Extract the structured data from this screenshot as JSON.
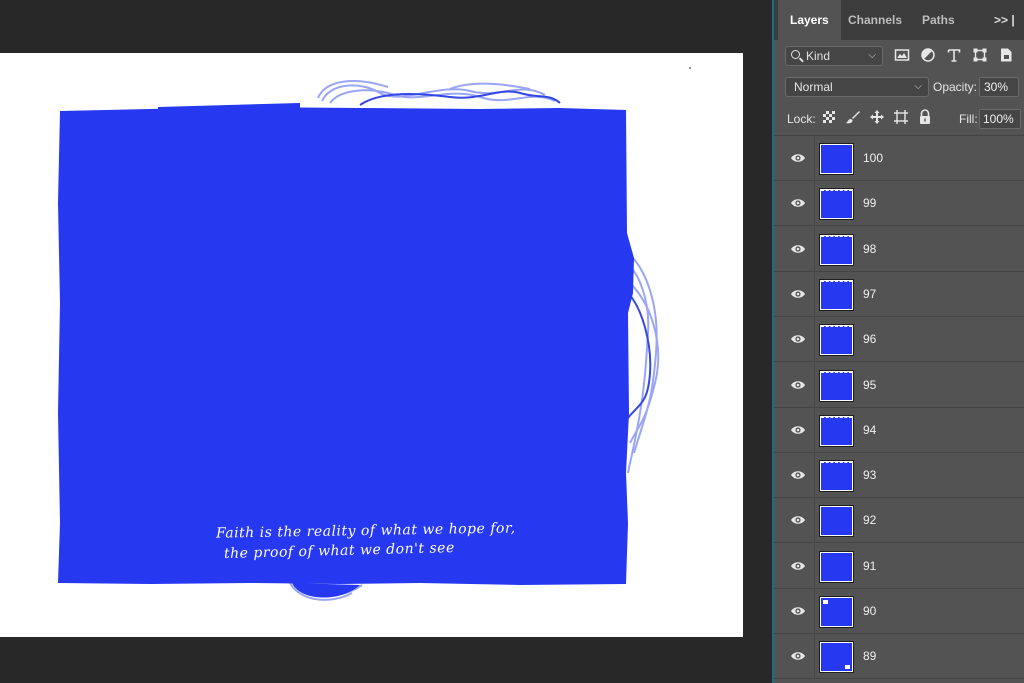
{
  "canvas": {
    "fill_color": "#2638F0",
    "scribble_color": "#9AA6F5",
    "caption_line1": "Faith is the reality of what we hope for,",
    "caption_line2": "the proof of what we don't see"
  },
  "panel": {
    "tabs": [
      {
        "label": "Layers",
        "active": true
      },
      {
        "label": "Channels",
        "active": false
      },
      {
        "label": "Paths",
        "active": false
      }
    ],
    "more_label": ">> |",
    "filter": {
      "kind_label": "Kind",
      "icons": [
        "image-filter-icon",
        "adjustment-filter-icon",
        "type-filter-icon",
        "shape-filter-icon",
        "smart-object-filter-icon"
      ]
    },
    "blend_mode": "Normal",
    "opacity_label": "Opacity:",
    "opacity_value": "30%",
    "lock_label": "Lock:",
    "lock_icons": [
      "lock-transparent-pixels-icon",
      "lock-image-pixels-icon",
      "lock-position-icon",
      "lock-artboard-icon",
      "lock-all-icon"
    ],
    "fill_label": "Fill:",
    "fill_value": "100%",
    "layers": [
      {
        "name": "100",
        "visible": true
      },
      {
        "name": "99",
        "visible": true
      },
      {
        "name": "98",
        "visible": true
      },
      {
        "name": "97",
        "visible": true
      },
      {
        "name": "96",
        "visible": true
      },
      {
        "name": "95",
        "visible": true
      },
      {
        "name": "94",
        "visible": true
      },
      {
        "name": "93",
        "visible": true
      },
      {
        "name": "92",
        "visible": true
      },
      {
        "name": "91",
        "visible": true
      },
      {
        "name": "90",
        "visible": true
      },
      {
        "name": "89",
        "visible": true
      }
    ]
  }
}
